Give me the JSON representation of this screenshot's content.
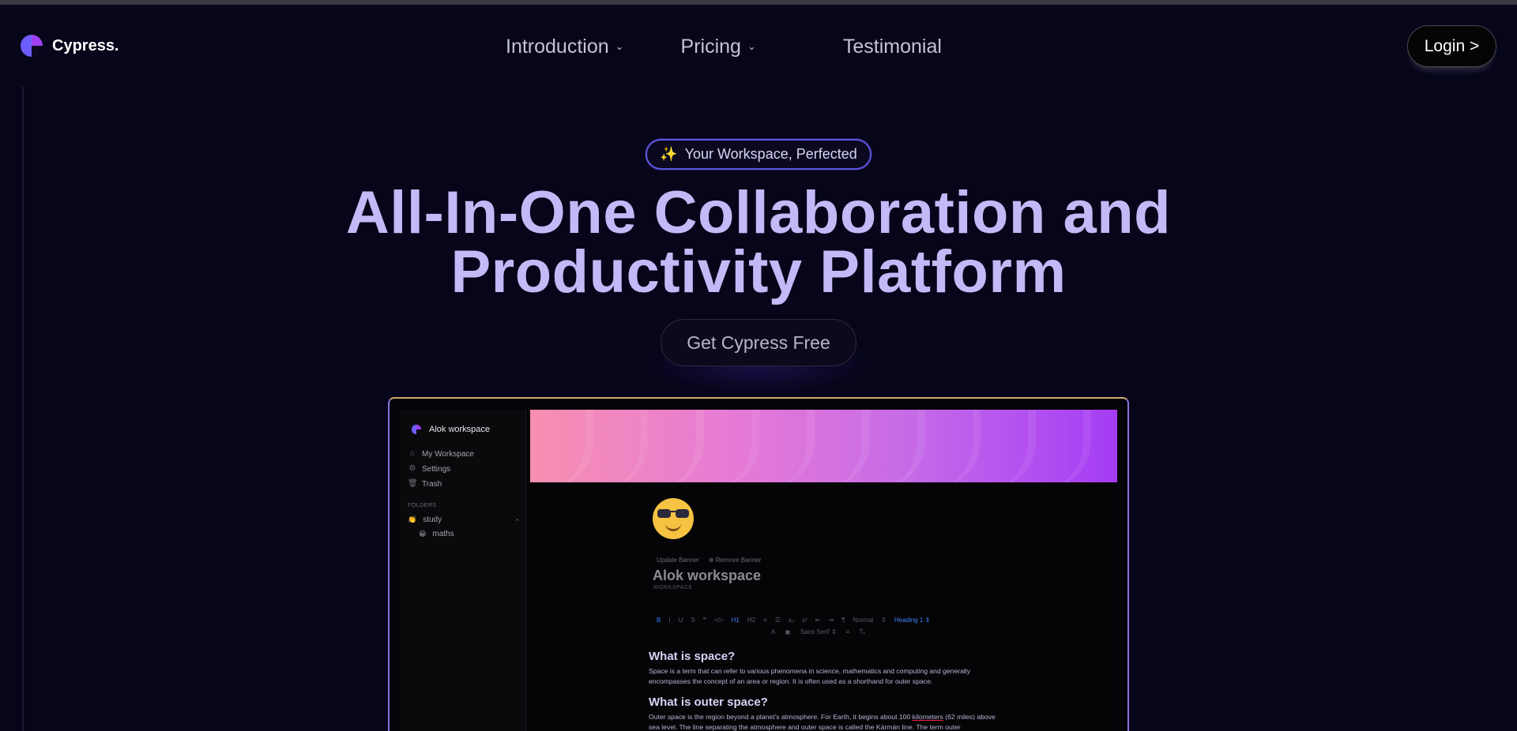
{
  "brand": {
    "name": "Cypress.",
    "colors": {
      "logo_primary": "#6d5dfc",
      "logo_accent": "#a040f0"
    }
  },
  "nav": [
    {
      "label": "Introduction",
      "has_dropdown": true
    },
    {
      "label": "Pricing",
      "has_dropdown": true
    },
    {
      "label": "Testimonial",
      "has_dropdown": false
    }
  ],
  "login_label": "Login >",
  "hero": {
    "badge": "Your Workspace, Perfected",
    "badge_icon": "sparkles-icon",
    "title_line1": "All-In-One Collaboration and",
    "title_line2": "Productivity Platform",
    "cta": "Get Cypress Free",
    "title_color": "#c3b9f7"
  },
  "preview": {
    "sidebar": {
      "workspace_name": "Alok workspace",
      "items": [
        {
          "label": "My Workspace",
          "icon": "home-icon"
        },
        {
          "label": "Settings",
          "icon": "gear-icon"
        },
        {
          "label": "Trash",
          "icon": "trash-icon"
        }
      ],
      "folders_label": "FOLDERS",
      "folders": [
        {
          "label": "study",
          "emoji": "👏",
          "expanded": true
        },
        {
          "label": "maths",
          "emoji": "😀",
          "child": true
        }
      ]
    },
    "doc": {
      "emoji": "😎",
      "update_banner": "Update Banner",
      "remove_banner": "Remove Banner",
      "title": "Alok workspace",
      "subtitle": "WORKSPACE",
      "toolbar": {
        "row1": [
          "B",
          "I",
          "U",
          "S",
          "❞",
          "</>",
          "H1",
          "H2",
          "≡",
          "☰",
          "x₂",
          "x²",
          "⇤",
          "⇥",
          "¶",
          "Normal",
          "⇕",
          "Heading 1 ⇕"
        ],
        "row2": [
          "A",
          "▣",
          "Sans Serif ⇕",
          "≡",
          "Tₓ"
        ]
      },
      "h1": "What is space?",
      "p1": "Space is a term that can refer to various phenomena in science, mathematics and computing and generally encompasses the concept of an area or region. It is often used as a shorthand for outer space.",
      "h2": "What is outer space?",
      "p2_before": "Outer space is the region beyond a planet's atmosphere. For Earth, it begins about 100 ",
      "p2_underlined": "kilometers",
      "p2_after": " (62 miles) above sea level. The line separating the atmosphere and outer space is called the Kármán line. The term outer"
    }
  }
}
